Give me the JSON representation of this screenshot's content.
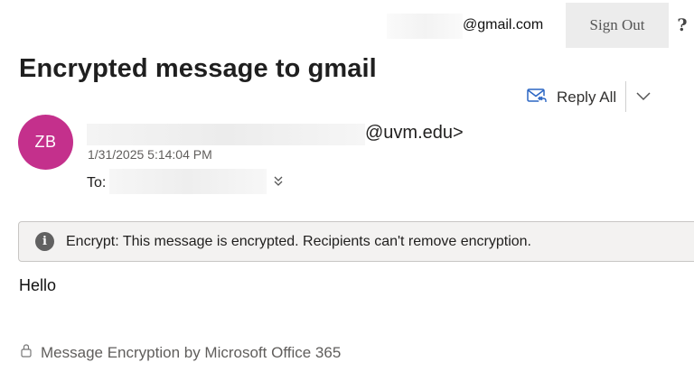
{
  "header": {
    "account_email": "@gmail.com",
    "sign_out_label": "Sign Out",
    "help_label": "?"
  },
  "message": {
    "subject": "Encrypted message to gmail",
    "reply_all_label": "Reply All",
    "avatar_initials": "ZB",
    "avatar_color": "#c4308c",
    "sender_domain": "@uvm.edu>",
    "timestamp": "1/31/2025 5:14:04 PM",
    "to_label": "To:",
    "info_text": "Encrypt: This message is encrypted. Recipients can't remove encryption.",
    "body": "Hello"
  },
  "footer": {
    "text": "Message Encryption by Microsoft Office 365"
  },
  "icons": {
    "reply_all": "mail-reply-all-icon",
    "more": "chevron-down-icon",
    "expand": "double-chevron-down-icon",
    "info": "info-icon",
    "lock": "lock-icon"
  }
}
